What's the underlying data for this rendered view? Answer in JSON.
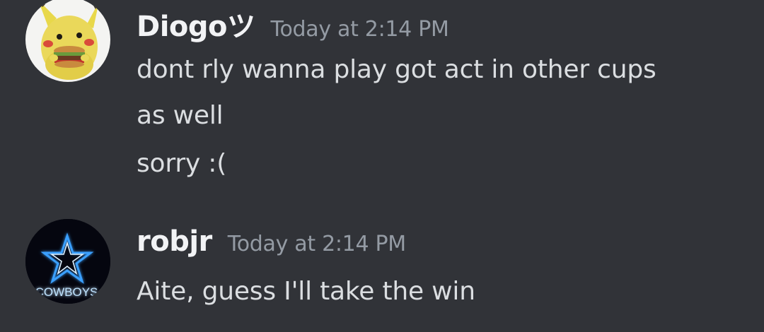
{
  "messages": [
    {
      "username": "Diogoツ",
      "timestamp": "Today at 2:14 PM",
      "avatar": "pikachu-burger-avatar",
      "lines": [
        "dont rly wanna play got act in other cups",
        "as well",
        "sorry :("
      ]
    },
    {
      "username": "robjr",
      "timestamp": "Today at 2:14 PM",
      "avatar": "cowboys-star-avatar",
      "avatar_text": "COWBOYS",
      "lines": [
        "Aite, guess I'll take the win"
      ]
    }
  ],
  "colors": {
    "background": "#313338",
    "username": "#f2f3f5",
    "timestamp": "#949ba4",
    "message_text": "#dbdee1",
    "cowboys_neon": "#3aa0ff"
  }
}
